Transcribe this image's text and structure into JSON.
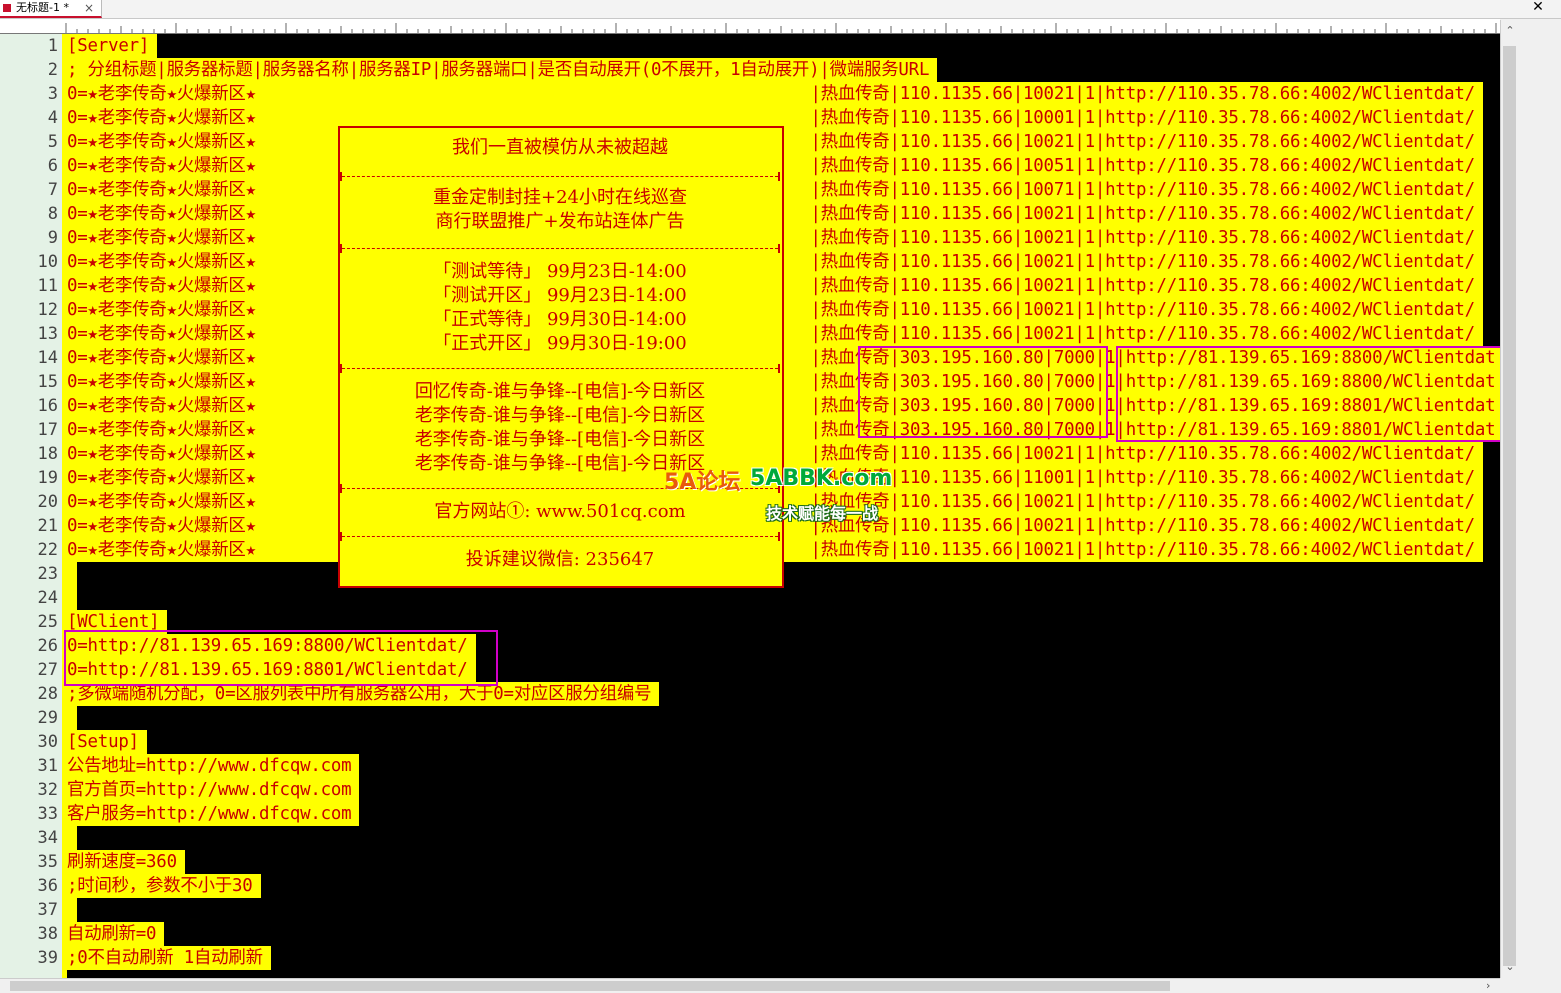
{
  "tab": {
    "title": "无标题-1 *",
    "close": "×"
  },
  "window": {
    "close": "✕"
  },
  "scroll": {
    "up": "⌃",
    "down": "⌄",
    "right": "›"
  },
  "lines": [
    {
      "n": "1",
      "text": "[Server]"
    },
    {
      "n": "2",
      "text": "; 分组标题|服务器标题|服务器名称|服务器IP|服务器端口|是否自动展开(0不展开，1自动展开)|微端服务URL"
    },
    {
      "n": "3",
      "text": "0=★老李传奇★火爆新区★                                                      |热血传奇|110.1135.66|10021|1|http://110.35.78.66:4002/WClientdat/"
    },
    {
      "n": "4",
      "text": "0=★老李传奇★火爆新区★                                                      |热血传奇|110.1135.66|10001|1|http://110.35.78.66:4002/WClientdat/"
    },
    {
      "n": "5",
      "text": "0=★老李传奇★火爆新区★                                                      |热血传奇|110.1135.66|10021|1|http://110.35.78.66:4002/WClientdat/"
    },
    {
      "n": "6",
      "text": "0=★老李传奇★火爆新区★                                                      |热血传奇|110.1135.66|10051|1|http://110.35.78.66:4002/WClientdat/"
    },
    {
      "n": "7",
      "text": "0=★老李传奇★火爆新区★                                                      |热血传奇|110.1135.66|10071|1|http://110.35.78.66:4002/WClientdat/"
    },
    {
      "n": "8",
      "text": "0=★老李传奇★火爆新区★                                                      |热血传奇|110.1135.66|10021|1|http://110.35.78.66:4002/WClientdat/"
    },
    {
      "n": "9",
      "text": "0=★老李传奇★火爆新区★                                                      |热血传奇|110.1135.66|10021|1|http://110.35.78.66:4002/WClientdat/"
    },
    {
      "n": "10",
      "text": "0=★老李传奇★火爆新区★                                                      |热血传奇|110.1135.66|10021|1|http://110.35.78.66:4002/WClientdat/"
    },
    {
      "n": "11",
      "text": "0=★老李传奇★火爆新区★                                                      |热血传奇|110.1135.66|10021|1|http://110.35.78.66:4002/WClientdat/"
    },
    {
      "n": "12",
      "text": "0=★老李传奇★火爆新区★                                                      |热血传奇|110.1135.66|10021|1|http://110.35.78.66:4002/WClientdat/"
    },
    {
      "n": "13",
      "text": "0=★老李传奇★火爆新区★                                                      |热血传奇|110.1135.66|10021|1|http://110.35.78.66:4002/WClientdat/"
    },
    {
      "n": "14",
      "text": "0=★老李传奇★火爆新区★                                                      |热血传奇|303.195.160.80|7000|1|http://81.139.65.169:8800/WClientdat"
    },
    {
      "n": "15",
      "text": "0=★老李传奇★火爆新区★                                                      |热血传奇|303.195.160.80|7000|1|http://81.139.65.169:8800/WClientdat"
    },
    {
      "n": "16",
      "text": "0=★老李传奇★火爆新区★                                                      |热血传奇|303.195.160.80|7000|1|http://81.139.65.169:8801/WClientdat"
    },
    {
      "n": "17",
      "text": "0=★老李传奇★火爆新区★                                                      |热血传奇|303.195.160.80|7000|1|http://81.139.65.169:8801/WClientdat"
    },
    {
      "n": "18",
      "text": "0=★老李传奇★火爆新区★                                                      |热血传奇|110.1135.66|10021|1|http://110.35.78.66:4002/WClientdat/"
    },
    {
      "n": "19",
      "text": "0=★老李传奇★火爆新区★                                                      |热血传奇|110.1135.66|11001|1|http://110.35.78.66:4002/WClientdat/"
    },
    {
      "n": "20",
      "text": "0=★老李传奇★火爆新区★                                                      |热血传奇|110.1135.66|10021|1|http://110.35.78.66:4002/WClientdat/"
    },
    {
      "n": "21",
      "text": "0=★老李传奇★火爆新区★                                                      |热血传奇|110.1135.66|10021|1|http://110.35.78.66:4002/WClientdat/"
    },
    {
      "n": "22",
      "text": "0=★老李传奇★火爆新区★                                                      |热血传奇|110.1135.66|10021|1|http://110.35.78.66:4002/WClientdat/"
    },
    {
      "n": "23",
      "text": ""
    },
    {
      "n": "24",
      "text": ""
    },
    {
      "n": "25",
      "text": "[WClient]"
    },
    {
      "n": "26",
      "text": "0=http://81.139.65.169:8800/WClientdat/"
    },
    {
      "n": "27",
      "text": "0=http://81.139.65.169:8801/WClientdat/"
    },
    {
      "n": "28",
      "text": ";多微端随机分配，0=区服列表中所有服务器公用，大于0=对应区服分组编号"
    },
    {
      "n": "29",
      "text": ""
    },
    {
      "n": "30",
      "text": "[Setup]"
    },
    {
      "n": "31",
      "text": "公告地址=http://www.dfcqw.com"
    },
    {
      "n": "32",
      "text": "官方首页=http://www.dfcqw.com"
    },
    {
      "n": "33",
      "text": "客户服务=http://www.dfcqw.com"
    },
    {
      "n": "34",
      "text": ""
    },
    {
      "n": "35",
      "text": "刷新速度=360"
    },
    {
      "n": "36",
      "text": ";时间秒，参数不小于30"
    },
    {
      "n": "37",
      "text": ""
    },
    {
      "n": "38",
      "text": "自动刷新=0"
    },
    {
      "n": "39",
      "text": ";0不自动刷新 1自动刷新"
    }
  ],
  "banner": {
    "s1": [
      "我们一直被模仿从未被超越"
    ],
    "s2": [
      "重金定制封挂+24小时在线巡查",
      "商行联盟推广+发布站连体广告"
    ],
    "s3": [
      "「测试等待」   99月23日-14:00",
      "「测试开区」   99月23日-14:00",
      "「正式等待」   99月30日-14:00",
      "「正式开区」   99月30日-19:00"
    ],
    "s4": [
      "回忆传奇-谁与争锋--[电信]-今日新区",
      "老李传奇-谁与争锋--[电信]-今日新区",
      "老李传奇-谁与争锋--[电信]-今日新区",
      "老李传奇-谁与争锋--[电信]-今日新区"
    ],
    "s5": [
      "官方网站①: www.501cq.com"
    ],
    "s6": [
      "投诉建议微信: 235647"
    ]
  },
  "watermark": {
    "logo": "5A论坛",
    "site": "5ABBK.com",
    "slogan": "技术赋能每一战"
  },
  "colors": {
    "text": "#c80000",
    "highlight": "#ffff00",
    "editor_bg": "#000000",
    "box": "#d100c8"
  }
}
